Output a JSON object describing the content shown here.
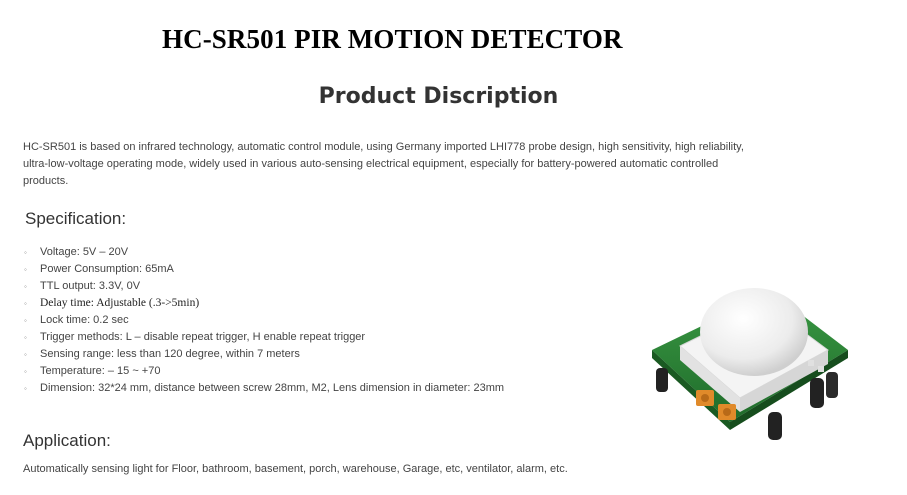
{
  "header": {
    "title": "HC-SR501 PIR MOTION DETECTOR",
    "section_title": "Product Discription"
  },
  "intro": {
    "text": "HC-SR501 is based on infrared technology, automatic control module, using Germany imported LHI778 probe design, high sensitivity, high reliability, ultra-low-voltage operating mode, widely used in various auto-sensing electrical equipment, especially for battery-powered automatic controlled products."
  },
  "specification": {
    "heading": "Specification:",
    "bullet": "◦",
    "items": [
      "Voltage: 5V – 20V",
      "Power Consumption: 65mA",
      "TTL output: 3.3V, 0V",
      "Delay time: Adjustable (.3->5min)",
      "Lock time: 0.2 sec",
      "Trigger methods: L – disable repeat trigger, H enable repeat trigger",
      "Sensing range: less than 120 degree, within 7 meters",
      "Temperature: – 15 ~ +70",
      "Dimension: 32*24 mm, distance between screw 28mm, M2, Lens dimension in diameter: 23mm"
    ]
  },
  "application": {
    "heading": "Application:",
    "text": "Automatically sensing light for Floor, bathroom, basement, porch, warehouse, Garage, etc, ventilator, alarm, etc."
  },
  "image": {
    "icon": "pir-sensor-module-image",
    "colors": {
      "board": "#2f8a3a",
      "dome": "#f2f2f2",
      "potentiometer": "#e08a2a",
      "capacitor": "#222222"
    }
  }
}
